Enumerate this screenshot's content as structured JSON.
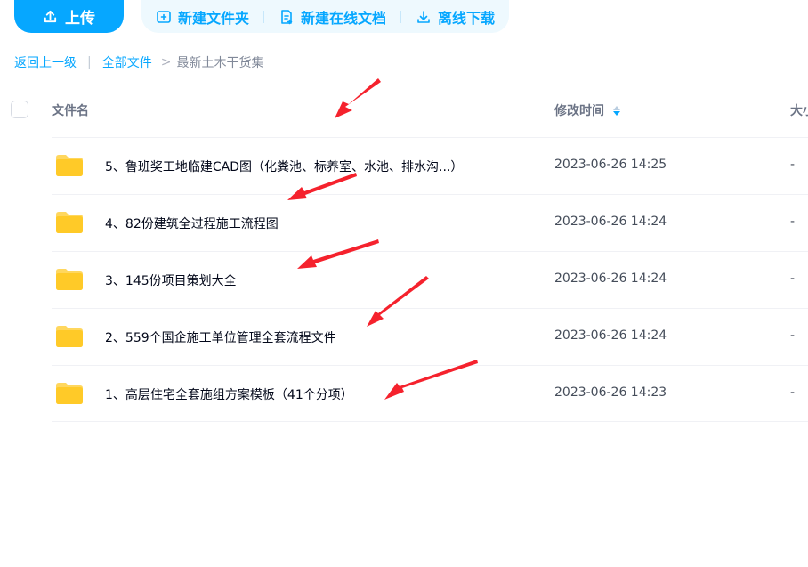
{
  "toolbar": {
    "upload_label": "上传",
    "new_folder_label": "新建文件夹",
    "new_doc_label": "新建在线文档",
    "offline_download_label": "离线下载"
  },
  "breadcrumb": {
    "back": "返回上一级",
    "all_files": "全部文件",
    "separator": "|",
    "arrow": ">",
    "current": "最新土木干货集"
  },
  "columns": {
    "name": "文件名",
    "modified": "修改时间",
    "size": "大小"
  },
  "files": [
    {
      "name": "5、鲁班奖工地临建CAD图（化粪池、标养室、水池、排水沟...）",
      "modified": "2023-06-26 14:25",
      "size": "-"
    },
    {
      "name": "4、82份建筑全过程施工流程图",
      "modified": "2023-06-26 14:24",
      "size": "-"
    },
    {
      "name": "3、145份项目策划大全",
      "modified": "2023-06-26 14:24",
      "size": "-"
    },
    {
      "name": "2、559个国企施工单位管理全套流程文件",
      "modified": "2023-06-26 14:24",
      "size": "-"
    },
    {
      "name": "1、高层住宅全套施组方案模板（41个分项）",
      "modified": "2023-06-26 14:23",
      "size": "-"
    }
  ],
  "icons": {
    "upload": "upload-icon",
    "new_folder": "folder-plus-icon",
    "new_doc": "document-plus-icon",
    "offline_download": "download-icon",
    "sort": "sort-icon",
    "folder": "folder-icon"
  },
  "colors": {
    "accent": "#06a7ff",
    "accent_bg": "#eef9fe",
    "folder": "#ffca28",
    "annotation_arrow": "#f5222d"
  }
}
